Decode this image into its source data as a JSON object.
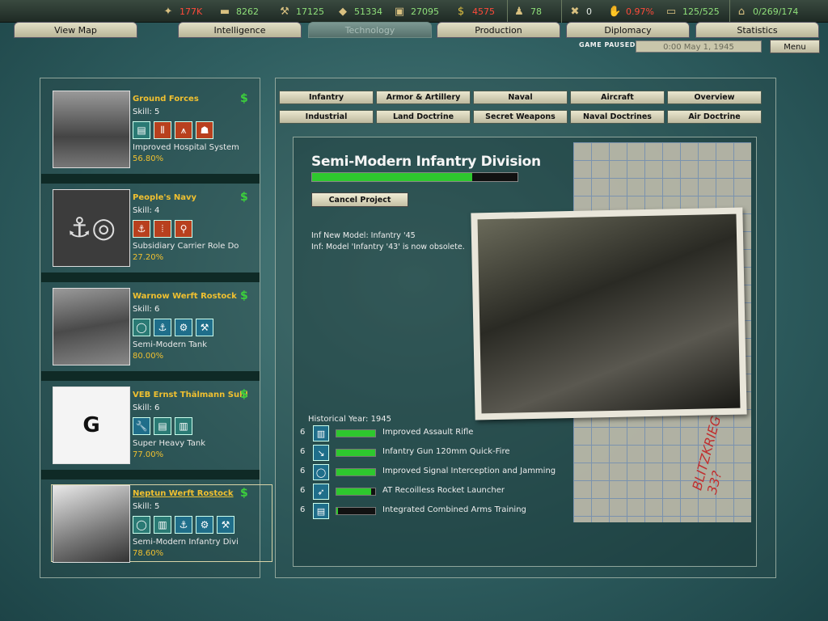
{
  "resources": [
    {
      "icon": "energy-icon",
      "glyph": "✦",
      "value": "177K",
      "color": "#ff4a3a"
    },
    {
      "icon": "metal-icon",
      "glyph": "▬",
      "value": "8262",
      "color": "#8fe07a"
    },
    {
      "icon": "rare-materials-icon",
      "glyph": "⚒",
      "value": "17125",
      "color": "#8fe07a"
    },
    {
      "icon": "oil-icon",
      "glyph": "💧",
      "value": "51334",
      "color": "#8fe07a"
    },
    {
      "icon": "supplies-icon",
      "glyph": "▣",
      "value": "27095",
      "color": "#8fe07a"
    },
    {
      "icon": "money-icon",
      "glyph": "$",
      "value": "4575",
      "color": "#ff4a3a"
    },
    {
      "icon": "manpower-icon",
      "glyph": "♟",
      "value": "78",
      "color": "#8fe07a"
    },
    {
      "icon": "diplomats-icon",
      "glyph": "✖",
      "value": "0",
      "color": "#eeeeee"
    },
    {
      "icon": "dissent-icon",
      "glyph": "✋",
      "value": "0.97%",
      "color": "#ff4a3a"
    },
    {
      "icon": "transports-icon",
      "glyph": "▭",
      "value": "125/525",
      "color": "#8fe07a"
    },
    {
      "icon": "ic-icon",
      "glyph": "⌂",
      "value": "0/269/174",
      "color": "#8fe07a"
    }
  ],
  "tabs": [
    "View Map",
    "Intelligence",
    "Technology",
    "Production",
    "Diplomacy",
    "Statistics"
  ],
  "status": {
    "paused": "GAME PAUSED",
    "date": "0:00 May 1, 1945",
    "menu": "Menu"
  },
  "teams": [
    {
      "name": "Ground Forces",
      "skill": "Skill: 5",
      "project": "Improved Hospital System",
      "pct": "56.80%"
    },
    {
      "name": "People's Navy",
      "skill": "Skill: 4",
      "project": "Subsidiary Carrier Role Do",
      "pct": "27.20%"
    },
    {
      "name": "Warnow Werft Rostock",
      "skill": "Skill: 6",
      "project": "Semi-Modern Tank",
      "pct": "80.00%"
    },
    {
      "name": "VEB Ernst Thälmann Suhl",
      "skill": "Skill: 6",
      "project": "Super Heavy Tank",
      "pct": "77.00%"
    },
    {
      "name": "Neptun Werft Rostock",
      "skill": "Skill: 5",
      "project": "Semi-Modern Infantry Divi",
      "pct": "78.60%"
    }
  ],
  "categories_row1": [
    "Infantry",
    "Armor & Artillery",
    "Naval",
    "Aircraft",
    "Overview"
  ],
  "categories_row2": [
    "Industrial",
    "Land Doctrine",
    "Secret Weapons",
    "Naval Doctrines",
    "Air Doctrine"
  ],
  "project": {
    "title": "Semi-Modern Infantry Division",
    "progress": 0.78,
    "cancel": "Cancel Project",
    "info1": "Inf New Model: Infantry '45",
    "info2": "Inf: Model 'Infantry '43' is now obsolete.",
    "historical_year": "Historical Year: 1945"
  },
  "components": [
    {
      "level": "6",
      "name": "Improved Assault Rifle",
      "progress": 1.0,
      "icon": "rifle-icon"
    },
    {
      "level": "6",
      "name": "Infantry Gun 120mm Quick-Fire",
      "progress": 1.0,
      "icon": "gun-icon"
    },
    {
      "level": "6",
      "name": "Improved Signal Interception and Jamming",
      "progress": 1.0,
      "icon": "bulb-icon"
    },
    {
      "level": "6",
      "name": "AT Recoilless Rocket Launcher",
      "progress": 0.9,
      "icon": "rocket-icon"
    },
    {
      "level": "6",
      "name": "Integrated Combined Arms Training",
      "progress": 0.04,
      "icon": "book-icon"
    }
  ],
  "notes_scribble": "BLITZKRIEG 33?"
}
